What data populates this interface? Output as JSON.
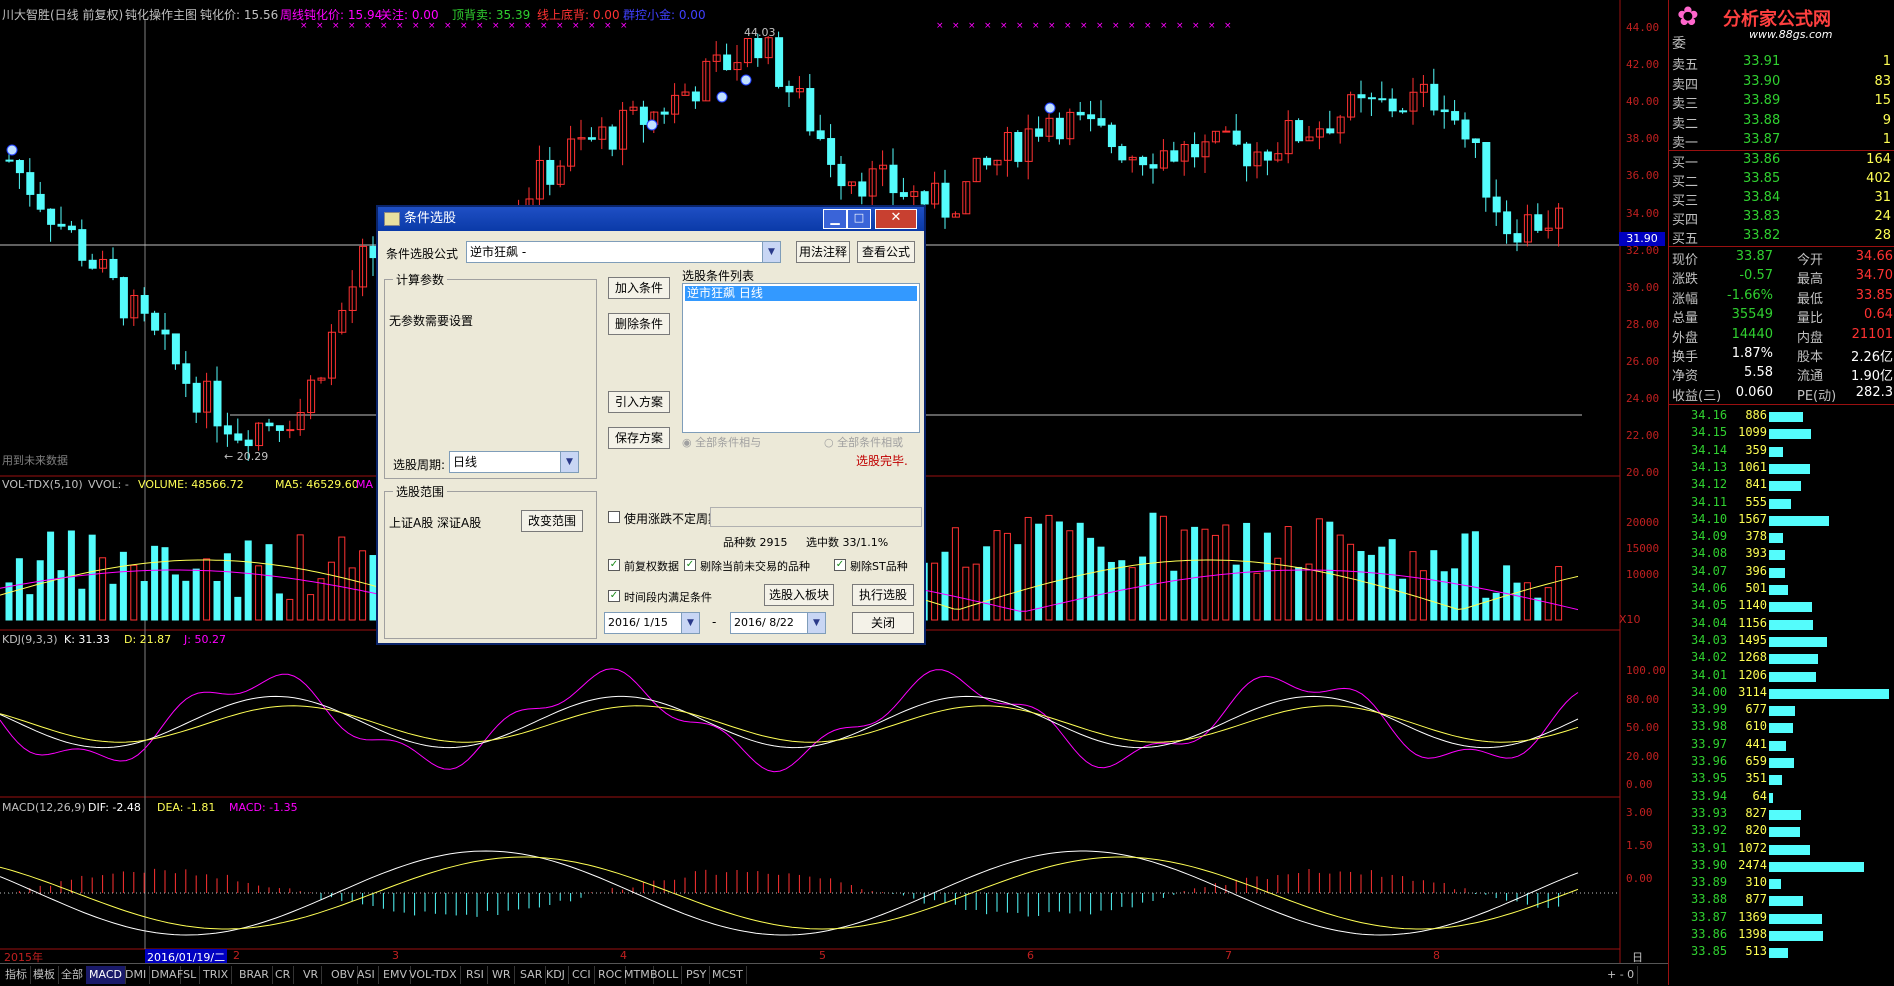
{
  "header": {
    "stock": "川大智胜(日线 前复权)",
    "indicator": "钝化操作主图",
    "dunhua": "钝化价: 15.56",
    "zhou": "周线钝化价: 15.94",
    "guanzhu": "关注: 0.00",
    "dingbei": "顶背卖: 35.39",
    "xianshang": "线上底背: 0.00",
    "qita": "群控小金: 0.00"
  },
  "price_axis": [
    "44.00",
    "42.00",
    "40.00",
    "38.00",
    "36.00",
    "34.00",
    "32.00",
    "30.00",
    "28.00",
    "26.00",
    "24.00",
    "22.00",
    "20.00"
  ],
  "current_price_tag": "31.90",
  "annotations": {
    "high": "44.03",
    "low": "← 20.29",
    "future": "用到未来数据"
  },
  "volume": {
    "title": "VOL-TDX(5,10)",
    "vol": "VVOL: -",
    "volume": "VOLUME: 48566.72",
    "ma5": "MA5: 46529.60",
    "ma10": "MA",
    "axis": [
      "20000",
      "15000",
      "10000"
    ],
    "unit": "X10"
  },
  "kdj": {
    "title": "KDJ(9,3,3)",
    "k": "K: 31.33",
    "d": "D: 21.87",
    "j": "J: 50.27",
    "axis": [
      "100.00",
      "80.00",
      "50.00",
      "20.00",
      "0.00"
    ]
  },
  "macd": {
    "title": "MACD(12,26,9)",
    "dif": "DIF: -2.48",
    "dea": "DEA: -1.81",
    "macd": "MACD: -1.35",
    "axis": [
      "3.00",
      "1.50",
      "0.00"
    ]
  },
  "dates": {
    "y2015": "2015年",
    "sel": "2016/01/19/二",
    "m2": "2",
    "m3": "3",
    "m4": "4",
    "m5": "5",
    "m6": "6",
    "m7": "7",
    "m8": "8",
    "period": "日线"
  },
  "tabs": [
    "指标",
    "模板",
    "全部",
    "MACD",
    "DMI",
    "DMA",
    "FSL",
    "TRIX",
    "BRAR",
    "CR",
    "VR",
    "OBV",
    "ASI",
    "EMV",
    "VOL-TDX",
    "RSI",
    "WR",
    "SAR",
    "KDJ",
    "CCI",
    "ROC",
    "MTM",
    "BOLL",
    "PSY",
    "MCST"
  ],
  "logo": {
    "name": "分析家公式网",
    "url": "www.88gs.com"
  },
  "order_book": {
    "wei": "委",
    "asks": [
      {
        "label": "卖五",
        "price": "33.91",
        "vol": "1"
      },
      {
        "label": "卖四",
        "price": "33.90",
        "vol": "83"
      },
      {
        "label": "卖三",
        "price": "33.89",
        "vol": "15"
      },
      {
        "label": "卖二",
        "price": "33.88",
        "vol": "9"
      },
      {
        "label": "卖一",
        "price": "33.87",
        "vol": "1"
      }
    ],
    "bids": [
      {
        "label": "买一",
        "price": "33.86",
        "vol": "164"
      },
      {
        "label": "买二",
        "price": "33.85",
        "vol": "402"
      },
      {
        "label": "买三",
        "price": "33.84",
        "vol": "31"
      },
      {
        "label": "买四",
        "price": "33.83",
        "vol": "24"
      },
      {
        "label": "买五",
        "price": "33.82",
        "vol": "28"
      }
    ]
  },
  "quote": [
    {
      "l1": "现价",
      "v1": "33.87",
      "l2": "今开",
      "v2": "34.66"
    },
    {
      "l1": "涨跌",
      "v1": "-0.57",
      "l2": "最高",
      "v2": "34.70"
    },
    {
      "l1": "涨幅",
      "v1": "-1.66%",
      "l2": "最低",
      "v2": "33.85"
    },
    {
      "l1": "总量",
      "v1": "35549",
      "l2": "量比",
      "v2": "0.64"
    },
    {
      "l1": "外盘",
      "v1": "14440",
      "l2": "内盘",
      "v2": "21101"
    },
    {
      "l1": "换手",
      "v1": "1.87%",
      "l2": "股本",
      "v2": "2.26亿"
    },
    {
      "l1": "净资",
      "v1": "5.58",
      "l2": "流通",
      "v2": "1.90亿"
    },
    {
      "l1": "收益(三)",
      "v1": "0.060",
      "l2": "PE(动)",
      "v2": "282.3"
    }
  ],
  "ticks": [
    {
      "p": "34.16",
      "v": "886",
      "f": 0.28
    },
    {
      "p": "34.15",
      "v": "1099",
      "f": 0.35
    },
    {
      "p": "34.14",
      "v": "359",
      "f": 0.12
    },
    {
      "p": "34.13",
      "v": "1061",
      "f": 0.34
    },
    {
      "p": "34.12",
      "v": "841",
      "f": 0.27
    },
    {
      "p": "34.11",
      "v": "555",
      "f": 0.18
    },
    {
      "p": "34.10",
      "v": "1567",
      "f": 0.5
    },
    {
      "p": "34.09",
      "v": "378",
      "f": 0.12
    },
    {
      "p": "34.08",
      "v": "393",
      "f": 0.13
    },
    {
      "p": "34.07",
      "v": "396",
      "f": 0.13
    },
    {
      "p": "34.06",
      "v": "501",
      "f": 0.16
    },
    {
      "p": "34.05",
      "v": "1140",
      "f": 0.36
    },
    {
      "p": "34.04",
      "v": "1156",
      "f": 0.37
    },
    {
      "p": "34.03",
      "v": "1495",
      "f": 0.48
    },
    {
      "p": "34.02",
      "v": "1268",
      "f": 0.41
    },
    {
      "p": "34.01",
      "v": "1206",
      "f": 0.39
    },
    {
      "p": "34.00",
      "v": "3114",
      "f": 1.0
    },
    {
      "p": "33.99",
      "v": "677",
      "f": 0.22
    },
    {
      "p": "33.98",
      "v": "610",
      "f": 0.2
    },
    {
      "p": "33.97",
      "v": "441",
      "f": 0.14
    },
    {
      "p": "33.96",
      "v": "659",
      "f": 0.21
    },
    {
      "p": "33.95",
      "v": "351",
      "f": 0.11
    },
    {
      "p": "33.94",
      "v": "64",
      "f": 0.03
    },
    {
      "p": "33.93",
      "v": "827",
      "f": 0.27
    },
    {
      "p": "33.92",
      "v": "820",
      "f": 0.26
    },
    {
      "p": "33.91",
      "v": "1072",
      "f": 0.34
    },
    {
      "p": "33.90",
      "v": "2474",
      "f": 0.79
    },
    {
      "p": "33.89",
      "v": "310",
      "f": 0.1
    },
    {
      "p": "33.88",
      "v": "877",
      "f": 0.28
    },
    {
      "p": "33.87",
      "v": "1369",
      "f": 0.44
    },
    {
      "p": "33.86",
      "v": "1398",
      "f": 0.45
    },
    {
      "p": "33.85",
      "v": "513",
      "f": 0.16
    }
  ],
  "dialog": {
    "title": "条件选股",
    "formula_label": "条件选股公式",
    "formula_value": "逆市狂飙         -",
    "usage_btn": "用法注释",
    "view_btn": "查看公式",
    "params_group": "计算参数",
    "no_params": "无参数需要设置",
    "period_label": "选股周期:",
    "period_value": "日线",
    "add_btn": "加入条件",
    "del_btn": "删除条件",
    "import_btn": "引入方案",
    "save_btn": "保存方案",
    "list_label": "选股条件列表",
    "list_item": "逆市狂飙   日线",
    "radio_and": "全部条件相与",
    "radio_or": "全部条件相或",
    "done": "选股完毕.",
    "range_group": "选股范围",
    "range_value": "上证A股 深证A股",
    "change_range_btn": "改变范围",
    "use_period": "使用涨跌不定周期",
    "count_total": "品种数 2915",
    "count_sel": "选中数 33/1.1%",
    "chk_fq": "前复权数据",
    "chk_exclude": "剔除当前未交易的品种",
    "chk_st": "剔除ST品种",
    "chk_time": "时间段内满足条件",
    "to_block_btn": "选股入板块",
    "exec_btn": "执行选股",
    "date_from": "2016/ 1/15",
    "dash": "-",
    "date_to": "2016/ 8/22",
    "close_btn": "关闭"
  },
  "colors": {
    "up": "#ff3232",
    "down": "#54fcfc",
    "axis": "#9a1010",
    "yellow": "#ffff55",
    "magenta": "#ff00ff",
    "white": "#ffffff"
  }
}
